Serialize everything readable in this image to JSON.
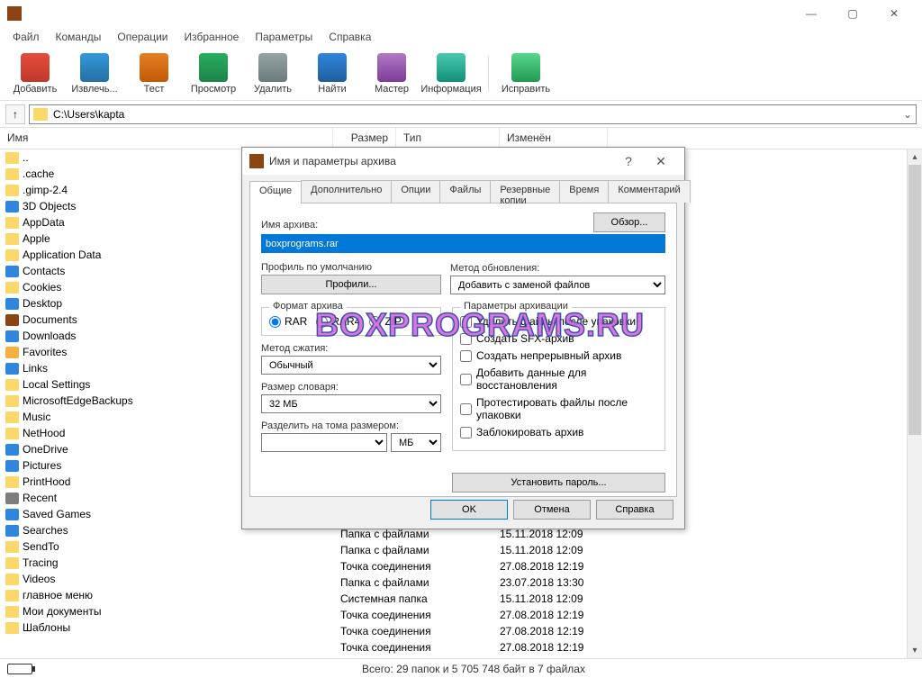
{
  "window": {
    "title": ""
  },
  "menu": [
    "Файл",
    "Команды",
    "Операции",
    "Избранное",
    "Параметры",
    "Справка"
  ],
  "toolbar": [
    {
      "label": "Добавить",
      "cls": "ic-add"
    },
    {
      "label": "Извлечь...",
      "cls": "ic-ext"
    },
    {
      "label": "Тест",
      "cls": "ic-test"
    },
    {
      "label": "Просмотр",
      "cls": "ic-view"
    },
    {
      "label": "Удалить",
      "cls": "ic-del"
    },
    {
      "label": "Найти",
      "cls": "ic-find"
    },
    {
      "label": "Мастер",
      "cls": "ic-wiz"
    },
    {
      "label": "Информация",
      "cls": "ic-info"
    },
    {
      "label": "Исправить",
      "cls": "ic-fix"
    }
  ],
  "address": "C:\\Users\\kapta",
  "columns": {
    "name": "Имя",
    "size": "Размер",
    "type": "Тип",
    "mod": "Изменён"
  },
  "files": [
    {
      "name": "..",
      "ico": "ico-up"
    },
    {
      "name": ".cache",
      "ico": "ico-folder"
    },
    {
      "name": ".gimp-2.4",
      "ico": "ico-folder"
    },
    {
      "name": "3D Objects",
      "ico": "ico-blue"
    },
    {
      "name": "AppData",
      "ico": "ico-folder"
    },
    {
      "name": "Apple",
      "ico": "ico-folder"
    },
    {
      "name": "Application Data",
      "ico": "ico-folder"
    },
    {
      "name": "Contacts",
      "ico": "ico-blue"
    },
    {
      "name": "Cookies",
      "ico": "ico-folder"
    },
    {
      "name": "Desktop",
      "ico": "ico-blue"
    },
    {
      "name": "Documents",
      "ico": "ico-green"
    },
    {
      "name": "Downloads",
      "ico": "ico-blue"
    },
    {
      "name": "Favorites",
      "ico": "ico-star"
    },
    {
      "name": "Links",
      "ico": "ico-blue"
    },
    {
      "name": "Local Settings",
      "ico": "ico-folder"
    },
    {
      "name": "MicrosoftEdgeBackups",
      "ico": "ico-folder"
    },
    {
      "name": "Music",
      "ico": "ico-folder"
    },
    {
      "name": "NetHood",
      "ico": "ico-folder"
    },
    {
      "name": "OneDrive",
      "ico": "ico-blue"
    },
    {
      "name": "Pictures",
      "ico": "ico-blue"
    },
    {
      "name": "PrintHood",
      "ico": "ico-folder"
    },
    {
      "name": "Recent",
      "ico": "ico-grey"
    },
    {
      "name": "Saved Games",
      "ico": "ico-blue"
    },
    {
      "name": "Searches",
      "ico": "ico-blue"
    },
    {
      "name": "SendTo",
      "ico": "ico-folder"
    },
    {
      "name": "Tracing",
      "ico": "ico-folder"
    },
    {
      "name": "Videos",
      "ico": "ico-folder"
    },
    {
      "name": "главное меню",
      "ico": "ico-folder"
    },
    {
      "name": "Мои документы",
      "ico": "ico-folder"
    },
    {
      "name": "Шаблоны",
      "ico": "ico-folder"
    }
  ],
  "rows_right": [
    {
      "type": "Папка с файлами",
      "date": "15.11.2018 12:09"
    },
    {
      "type": "Папка с файлами",
      "date": "15.11.2018 12:09"
    },
    {
      "type": "Точка соединения",
      "date": "27.08.2018 12:19"
    },
    {
      "type": "Папка с файлами",
      "date": "23.07.2018 13:30"
    },
    {
      "type": "Системная папка",
      "date": "15.11.2018 12:09"
    },
    {
      "type": "Точка соединения",
      "date": "27.08.2018 12:19"
    },
    {
      "type": "Точка соединения",
      "date": "27.08.2018 12:19"
    },
    {
      "type": "Точка соединения",
      "date": "27.08.2018 12:19"
    }
  ],
  "status": "Всего: 29 папок и 5 705 748 байт в 7 файлах",
  "dialog": {
    "title": "Имя и параметры архива",
    "help": "?",
    "close": "✕",
    "tabs": [
      "Общие",
      "Дополнительно",
      "Опции",
      "Файлы",
      "Резервные копии",
      "Время",
      "Комментарий"
    ],
    "archive_label": "Имя архива:",
    "browse": "Обзор...",
    "archive_name": "boxprograms.rar",
    "profile_label": "Профиль по умолчанию",
    "profiles_btn": "Профили...",
    "update_label": "Метод обновления:",
    "update_value": "Добавить с заменой файлов",
    "format_legend": "Формат архива",
    "formats": [
      "RAR",
      "RAR4",
      "ZIP"
    ],
    "compress_label": "Метод сжатия:",
    "compress_value": "Обычный",
    "dict_label": "Размер словаря:",
    "dict_value": "32 МБ",
    "split_label": "Разделить на тома размером:",
    "split_unit": "МБ",
    "params_legend": "Параметры архивации",
    "checks": [
      "Удалить файлы после упаковки",
      "Создать SFX-архив",
      "Создать непрерывный архив",
      "Добавить данные для восстановления",
      "Протестировать файлы после упаковки",
      "Заблокировать архив"
    ],
    "password_btn": "Установить пароль...",
    "ok": "OK",
    "cancel": "Отмена",
    "help_btn": "Справка"
  },
  "watermark": "BOXPROGRAMS.RU"
}
